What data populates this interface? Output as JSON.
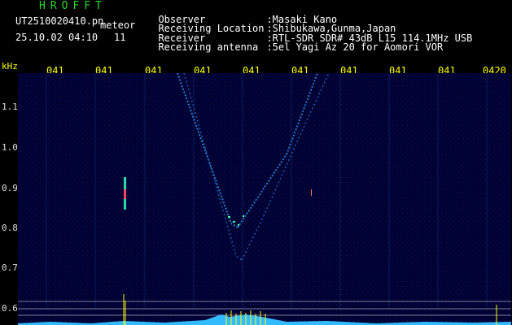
{
  "header": {
    "brand": "HROFFT",
    "filename": "UT2510020410.pn",
    "tag": "meteor",
    "datetime": "25.10.02 04:10",
    "count": "11",
    "info": [
      {
        "key": "Observer",
        "value": ":Masaki Kano"
      },
      {
        "key": "Receiving Location",
        "value": ":Shibukawa,Gunma,Japan"
      },
      {
        "key": "Receiver",
        "value": ":RTL-SDR SDR# 43dB L15 114.1MHz USB"
      },
      {
        "key": "Receiving antenna",
        "value": ":5el Yagi Az 20 for Aomori VOR"
      }
    ]
  },
  "axis": {
    "unit": "kHz",
    "y_labels": [
      "1.1",
      "1.0",
      "0.9",
      "0.8",
      "0.7",
      "0.6"
    ],
    "minute_labels": [
      "041",
      "041",
      "041",
      "041",
      "041",
      "041",
      "041",
      "041",
      "041",
      "0420"
    ]
  },
  "colors": {
    "background": "#000033",
    "header_green": "#22dd22",
    "label_yellow": "#ffff00",
    "signal_cyan": "#33bbff"
  }
}
